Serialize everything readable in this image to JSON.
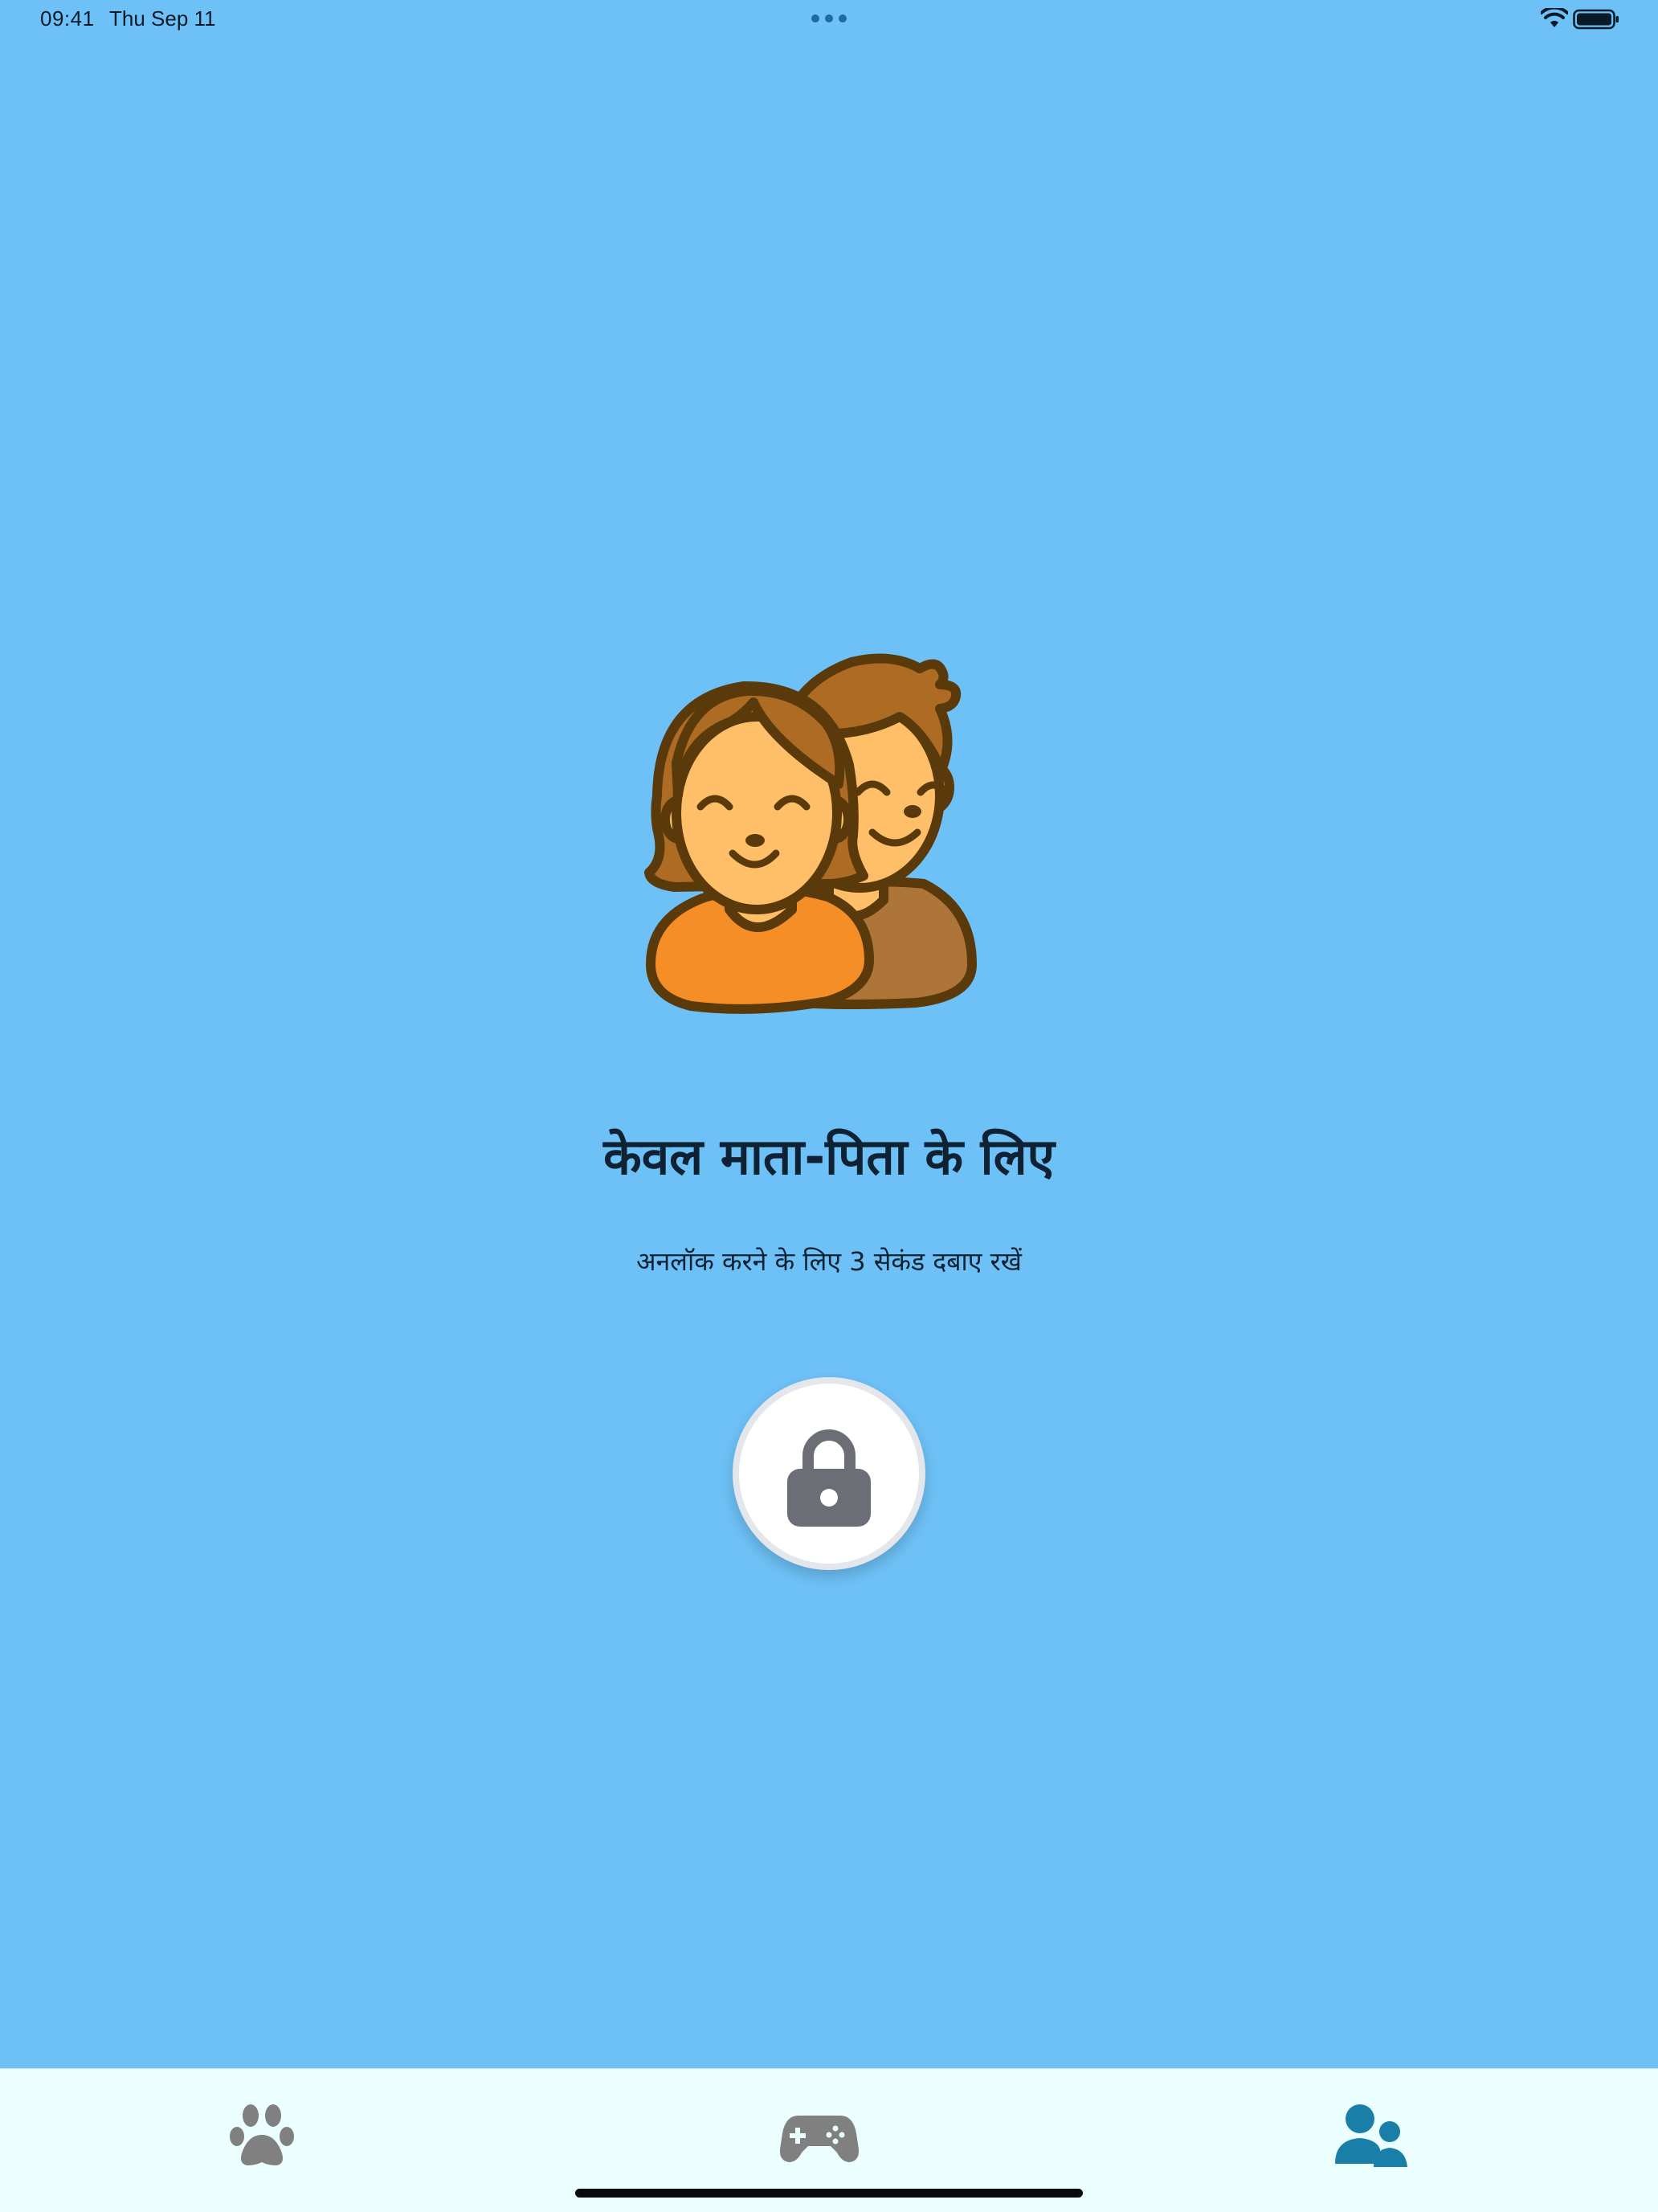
{
  "status_bar": {
    "time": "09:41",
    "date": "Thu Sep 11"
  },
  "icons": {
    "wifi": "wifi-icon",
    "battery": "battery-icon",
    "lock": "lock-icon",
    "illustration": "parents-illustration"
  },
  "main": {
    "title": "केवल माता-पिता के लिए",
    "subtitle": "अनलॉक करने के लिए 3 सेकंड दबाए रखें"
  },
  "tabs": [
    {
      "icon": "paw-icon",
      "selected": false
    },
    {
      "icon": "gamepad-icon",
      "selected": false
    },
    {
      "icon": "parents-icon",
      "selected": true
    }
  ],
  "colors": {
    "background": "#6ec1f7",
    "tab_bar": "#ebffff",
    "tab_active": "#1a7fa8",
    "tab_inactive": "#808080",
    "lock_body": "#6b6f75"
  }
}
